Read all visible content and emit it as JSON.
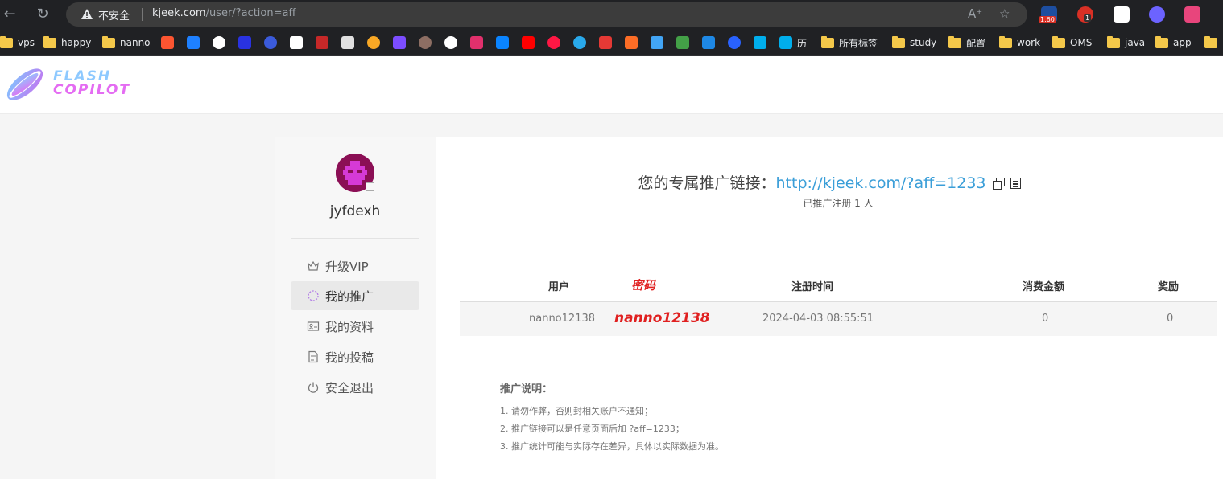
{
  "browser": {
    "security_label": "不安全",
    "url_host": "kjeek.com",
    "url_path": "/user/?action=aff",
    "extension_badge": "1.60",
    "abp_badge": "1",
    "bookmarks": [
      {
        "type": "folder",
        "label": "vps"
      },
      {
        "type": "folder",
        "label": "happy"
      },
      {
        "type": "folder",
        "label": "nanno"
      },
      {
        "type": "folder",
        "label": "历"
      },
      {
        "type": "folder",
        "label": "所有标签"
      },
      {
        "type": "folder",
        "label": "study"
      },
      {
        "type": "folder",
        "label": "配置"
      },
      {
        "type": "folder",
        "label": "work"
      },
      {
        "type": "folder",
        "label": "OMS"
      },
      {
        "type": "folder",
        "label": "java"
      },
      {
        "type": "folder",
        "label": "app"
      }
    ]
  },
  "site": {
    "logo_line1": "FLASH",
    "logo_line2": "COPILOT"
  },
  "sidebar": {
    "username": "jyfdexh",
    "menu": [
      {
        "icon": "crown-icon",
        "label": "升级VIP"
      },
      {
        "icon": "spinner-icon",
        "label": "我的推广"
      },
      {
        "icon": "id-card-icon",
        "label": "我的资料"
      },
      {
        "icon": "document-icon",
        "label": "我的投稿"
      },
      {
        "icon": "power-icon",
        "label": "安全退出"
      }
    ]
  },
  "main": {
    "aff_label": "您的专属推广链接：",
    "aff_link": "http://kjeek.com/?aff=1233",
    "aff_count": "已推广注册 1 人",
    "table": {
      "headers": {
        "user": "用户",
        "password": "密码",
        "reg_time": "注册时间",
        "spend": "消费金额",
        "reward": "奖励"
      },
      "rows": [
        {
          "user": "nanno12138",
          "password": "nanno12138",
          "reg_time": "2024-04-03 08:55:51",
          "spend": "0",
          "reward": "0"
        }
      ]
    },
    "notes": {
      "title": "推广说明：",
      "items": [
        "1. 请勿作弊，否则封相关账户不通知；",
        "2. 推广链接可以是任意页面后加 ?aff=1233；",
        "3. 推广统计可能与实际存在差异，具体以实际数据为准。"
      ]
    }
  }
}
